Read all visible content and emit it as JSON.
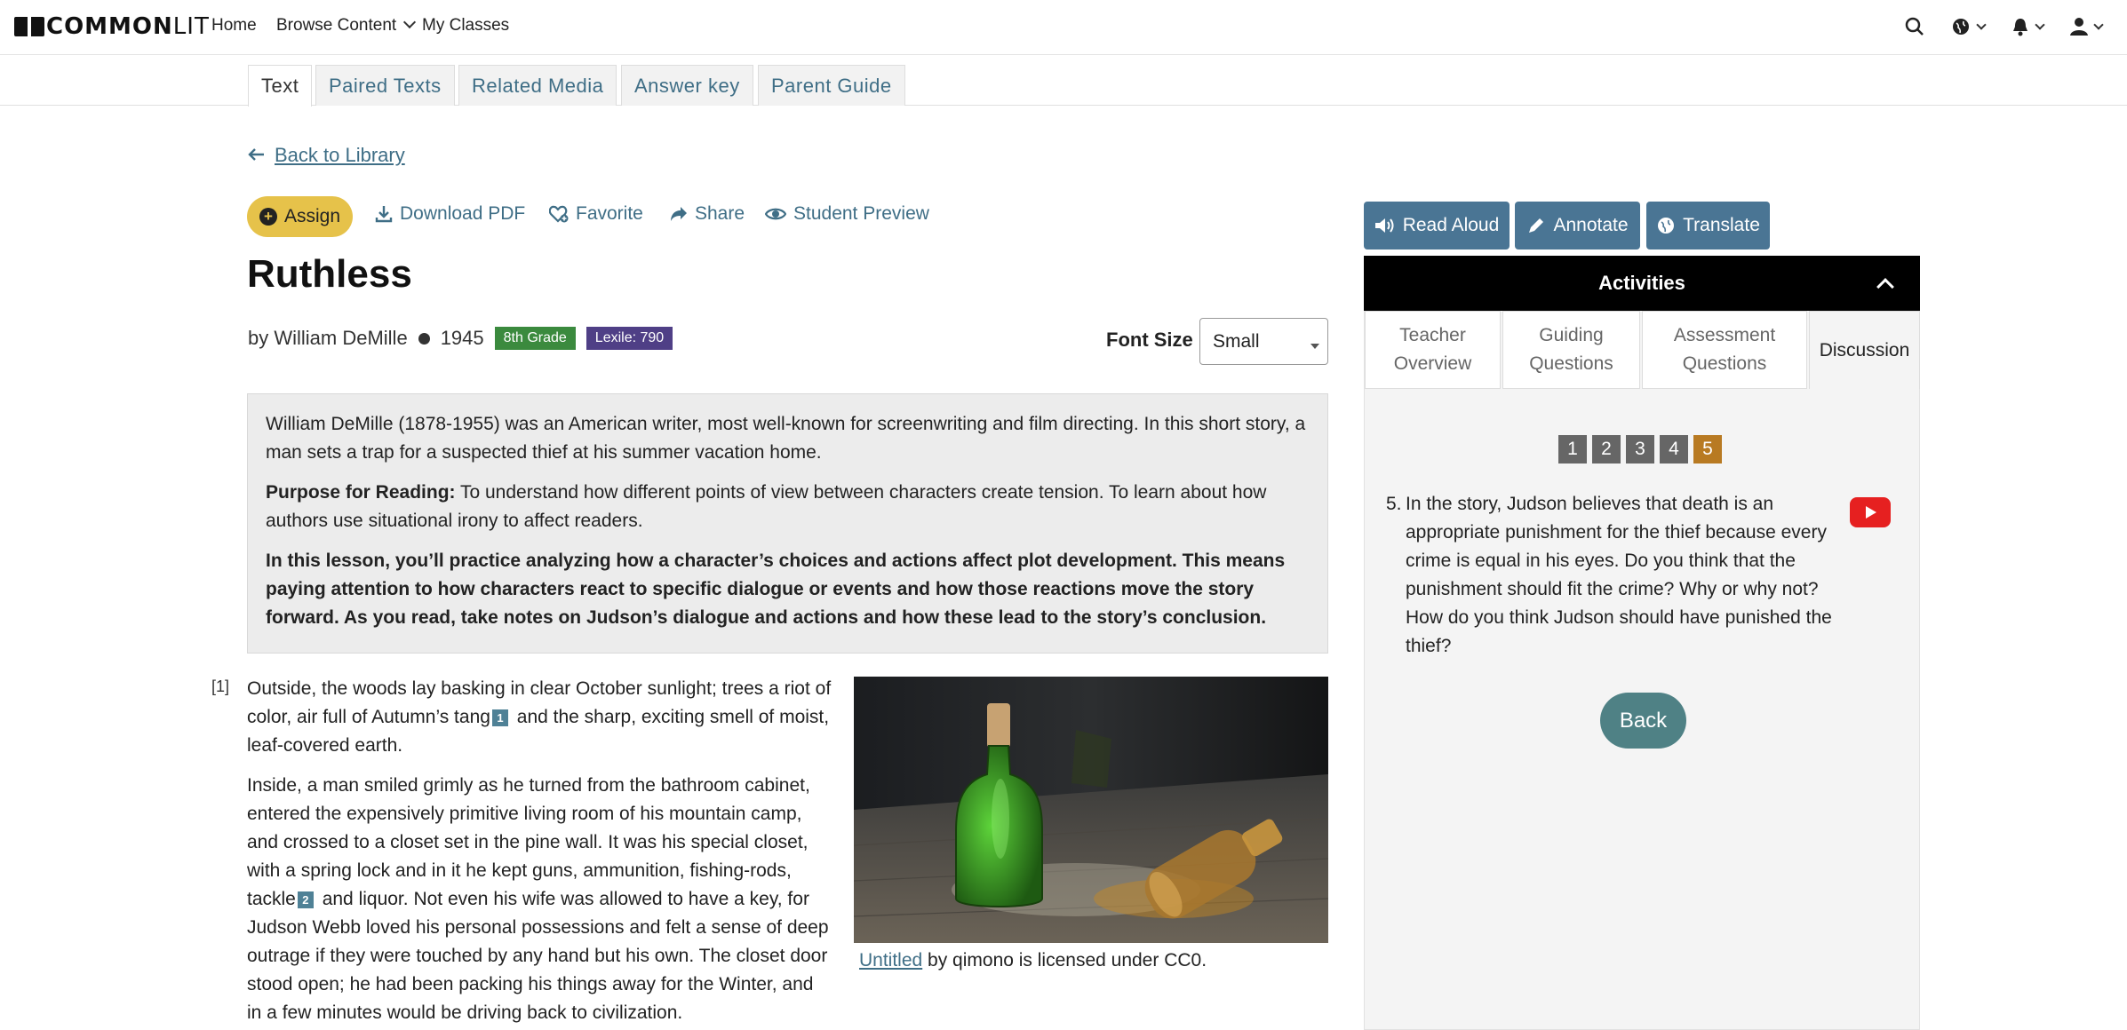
{
  "nav": {
    "logo_common": "COMMON",
    "logo_lit": "LIT",
    "home": "Home",
    "browse": "Browse Content",
    "classes": "My Classes"
  },
  "tabs": [
    "Text",
    "Paired Texts",
    "Related Media",
    "Answer key",
    "Parent Guide"
  ],
  "back_to_library": "Back to Library",
  "actions": {
    "assign": "Assign",
    "download": "Download PDF",
    "favorite": "Favorite",
    "share": "Share",
    "preview": "Student Preview"
  },
  "text": {
    "title": "Ruthless",
    "author": "by William DeMille",
    "year": "1945",
    "grade": "8th Grade",
    "lexile": "Lexile: 790"
  },
  "font_size": {
    "label": "Font Size",
    "value": "Small"
  },
  "intro": {
    "summary": "William DeMille (1878-1955) was an American writer, most well-known for screenwriting and film directing. In this short story, a man sets a trap for a suspected thief at his summer vacation home.",
    "purpose_label": "Purpose for Reading:",
    "purpose": " To understand how different points of view between characters create tension. To learn about how authors use situational irony to affect readers.",
    "lesson": "In this lesson, you’ll practice analyzing how a character’s choices and actions affect plot development. This means paying attention to how characters react to specific dialogue or events and how those reactions move the story forward. As you read, take notes on Judson’s dialogue and actions and how these lead to the story’s conclusion."
  },
  "story": {
    "para_num": "[1]",
    "p1a": "Outside, the woods lay basking in clear October sunlight; trees a riot of color, air full of Autumn’s tang",
    "fn1": "1",
    "p1b": " and the sharp, exciting smell of moist, leaf-covered earth.",
    "p2a": "Inside, a man smiled grimly as he turned from the bathroom cabinet, entered the expensively primitive living room of his mountain camp, and crossed to a closet set in the pine wall. It was his special closet, with a spring lock and in it he kept guns, ammunition, fishing-rods, tackle",
    "fn2": "2",
    "p2b": " and liquor. Not even his wife was allowed to have a key, for Judson Webb loved his personal possessions and felt a sense of deep outrage if they were touched by any hand but his own. The closet door stood open; he had been packing his things away for the Winter, and in a few minutes would be driving back to civilization."
  },
  "image_caption": {
    "link": "Untitled",
    "rest": " by qimono is licensed under CC0."
  },
  "tools": {
    "read_aloud": "Read Aloud",
    "annotate": "Annotate",
    "translate": "Translate"
  },
  "activities": {
    "title": "Activities",
    "tabs": [
      {
        "line1": "Teacher",
        "line2": "Overview"
      },
      {
        "line1": "Guiding",
        "line2": "Questions"
      },
      {
        "line1": "Assessment",
        "line2": "Questions"
      },
      {
        "line1": "Discussion",
        "line2": ""
      }
    ],
    "question_numbers": [
      "1",
      "2",
      "3",
      "4",
      "5"
    ],
    "question_num": "5.",
    "question": "In the story, Judson believes that death is an appropriate punishment for the thief because every crime is equal in his eyes. Do you think that the punishment should fit the crime? Why or why not? How do you think Judson should have punished the thief?",
    "back": "Back"
  }
}
